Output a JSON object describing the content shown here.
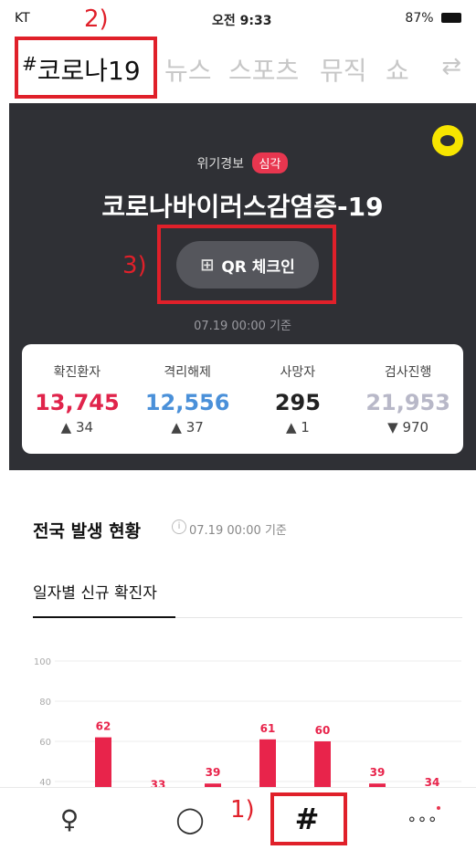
{
  "status": {
    "carrier": "KT",
    "time": "오전 9:33",
    "battery": "87%"
  },
  "tabs": [
    {
      "hash": "#",
      "label": "코로나19"
    },
    {
      "label": "뉴스"
    },
    {
      "label": "스포츠"
    },
    {
      "label": "뮤직"
    },
    {
      "label": "쇼"
    }
  ],
  "tabs_extra": {
    "swap": "⇄"
  },
  "hero": {
    "alert_label": "위기경보",
    "alert_badge": "심각",
    "title": "코로나바이러스감염증-19",
    "qr_button": "QR 체크인",
    "qr_icon": "⊞",
    "date": "07.19 00:00 기준"
  },
  "stats": [
    {
      "label": "확진환자",
      "value": "13,745",
      "delta": "▲ 34",
      "color": "#e0244b"
    },
    {
      "label": "격리해제",
      "value": "12,556",
      "delta": "▲ 37",
      "color": "#4a90d9"
    },
    {
      "label": "사망자",
      "value": "295",
      "delta": "▲ 1",
      "color": "#222222"
    },
    {
      "label": "검사진행",
      "value": "21,953",
      "delta": "▼ 970",
      "color": "#b8b8c8"
    }
  ],
  "section": {
    "title": "전국 발생 현황",
    "info": "i",
    "date": "07.19 00:00 기준",
    "sub_tab": "일자별 신규 확진자"
  },
  "chart_data": {
    "type": "bar",
    "yticks": [
      100,
      80,
      60,
      40
    ],
    "values": [
      62,
      33,
      39,
      61,
      60,
      39,
      34
    ],
    "color": "#e8244b"
  },
  "nav": {
    "profile": "♀",
    "chat": "◯",
    "hash": "#",
    "more": "∘∘∘"
  },
  "annotations": {
    "one": "1)",
    "two": "2)",
    "three": "3)"
  }
}
